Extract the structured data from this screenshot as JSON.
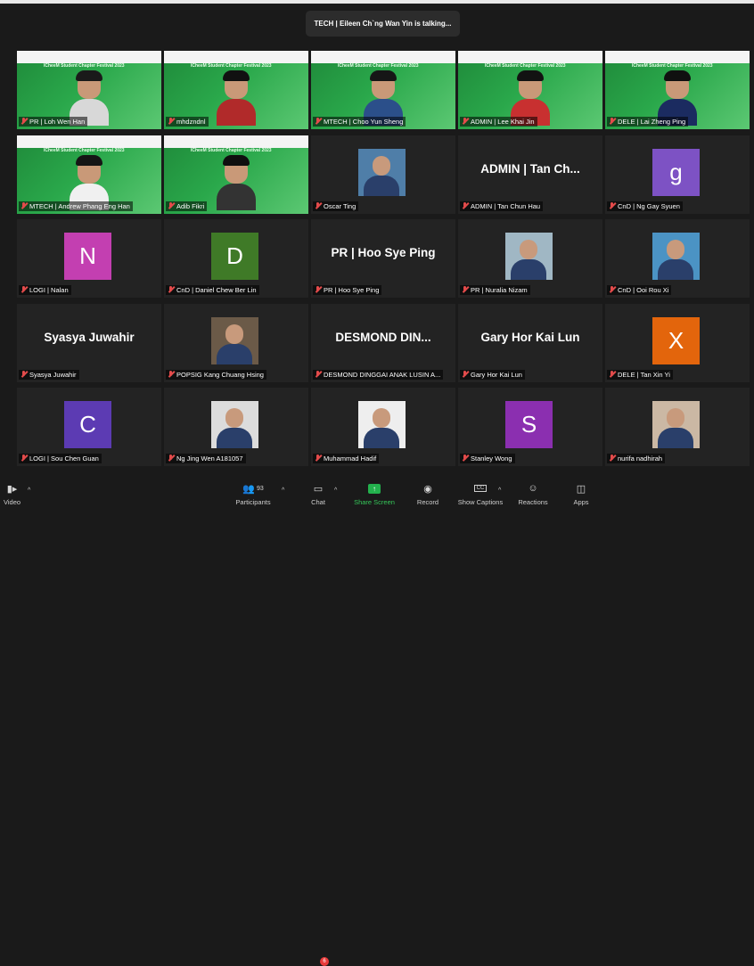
{
  "status_banner": "TECH | Eileen Ch`ng Wan Yin is talking...",
  "meeting_banner": "ICheeM Student Chapter Festival 2023",
  "participants": [
    {
      "name": "PR | Loh Wen Han",
      "type": "video",
      "shirt": "#d8d8d8",
      "hair": "#1a1a1a"
    },
    {
      "name": "mhdzndnl",
      "type": "video",
      "shirt": "#b12a2a",
      "hair": "#111111"
    },
    {
      "name": "MTECH | Choo Yun Sheng",
      "type": "video",
      "shirt": "#2b4f8a",
      "hair": "#161616"
    },
    {
      "name": "ADMIN | Lee Khai Jin",
      "type": "video",
      "shirt": "#c83030",
      "hair": "#121212"
    },
    {
      "name": "DELE | Lai Zheng Ping",
      "type": "video",
      "shirt": "#1b2b60",
      "hair": "#101010"
    },
    {
      "name": "MTECH | Andrew Phang Eng Han",
      "type": "video",
      "shirt": "#f0f0f0",
      "hair": "#151515"
    },
    {
      "name": "Adib Fikri",
      "type": "video",
      "shirt": "#333333",
      "hair": "#0f0f0f"
    },
    {
      "name": "Oscar Ting",
      "type": "photo",
      "bg": "#4f7ea8"
    },
    {
      "name": "ADMIN | Tan Chun Hau",
      "type": "text",
      "display": "ADMIN | Tan Ch..."
    },
    {
      "name": "CnD | Ng Gay Syuen",
      "type": "letter",
      "letter": "g",
      "color": "#7d52c4"
    },
    {
      "name": "LOGI | Nalan",
      "type": "letter",
      "letter": "N",
      "color": "#c33fb1"
    },
    {
      "name": "CnD | Daniel Chew Ber Lin",
      "type": "letter",
      "letter": "D",
      "color": "#3f7a27"
    },
    {
      "name": "PR | Hoo Sye Ping",
      "type": "text",
      "display": "PR | Hoo Sye Ping"
    },
    {
      "name": "PR | Nuralia Nizam",
      "type": "photo",
      "bg": "#a0b7c4"
    },
    {
      "name": "CnD | Ooi Rou Xi",
      "type": "photo",
      "bg": "#4b93c4"
    },
    {
      "name": "Syasya Juwahir",
      "type": "text",
      "display": "Syasya Juwahir"
    },
    {
      "name": "POPSIG Kang Chuang Hsing",
      "type": "photo",
      "bg": "#6b5a48"
    },
    {
      "name": "DESMOND DINGGAI ANAK LUSIN A...",
      "type": "text",
      "display": "DESMOND  DIN..."
    },
    {
      "name": "Gary Hor Kai Lun",
      "type": "text",
      "display": "Gary Hor Kai Lun"
    },
    {
      "name": "DELE | Tan Xin Yi",
      "type": "letter",
      "letter": "X",
      "color": "#e3650c"
    },
    {
      "name": "LOGI | Sou Chen Guan",
      "type": "letter",
      "letter": "C",
      "color": "#5c3bb3"
    },
    {
      "name": "Ng Jing Wen A181057",
      "type": "photo",
      "bg": "#dcdcdc"
    },
    {
      "name": "Muhammad Hadif",
      "type": "photo",
      "bg": "#eeeeee"
    },
    {
      "name": "Stanley Wong",
      "type": "letter",
      "letter": "S",
      "color": "#8b2fb0"
    },
    {
      "name": "nurifa nadhirah",
      "type": "photo",
      "bg": "#cbb8a4"
    }
  ],
  "toolbar": {
    "video": "Video",
    "participants": "Participants",
    "participants_count": "93",
    "chat": "Chat",
    "chat_badge": "6",
    "share_screen": "Share Screen",
    "record": "Record",
    "captions": "Show Captions",
    "reactions": "Reactions",
    "apps": "Apps"
  }
}
